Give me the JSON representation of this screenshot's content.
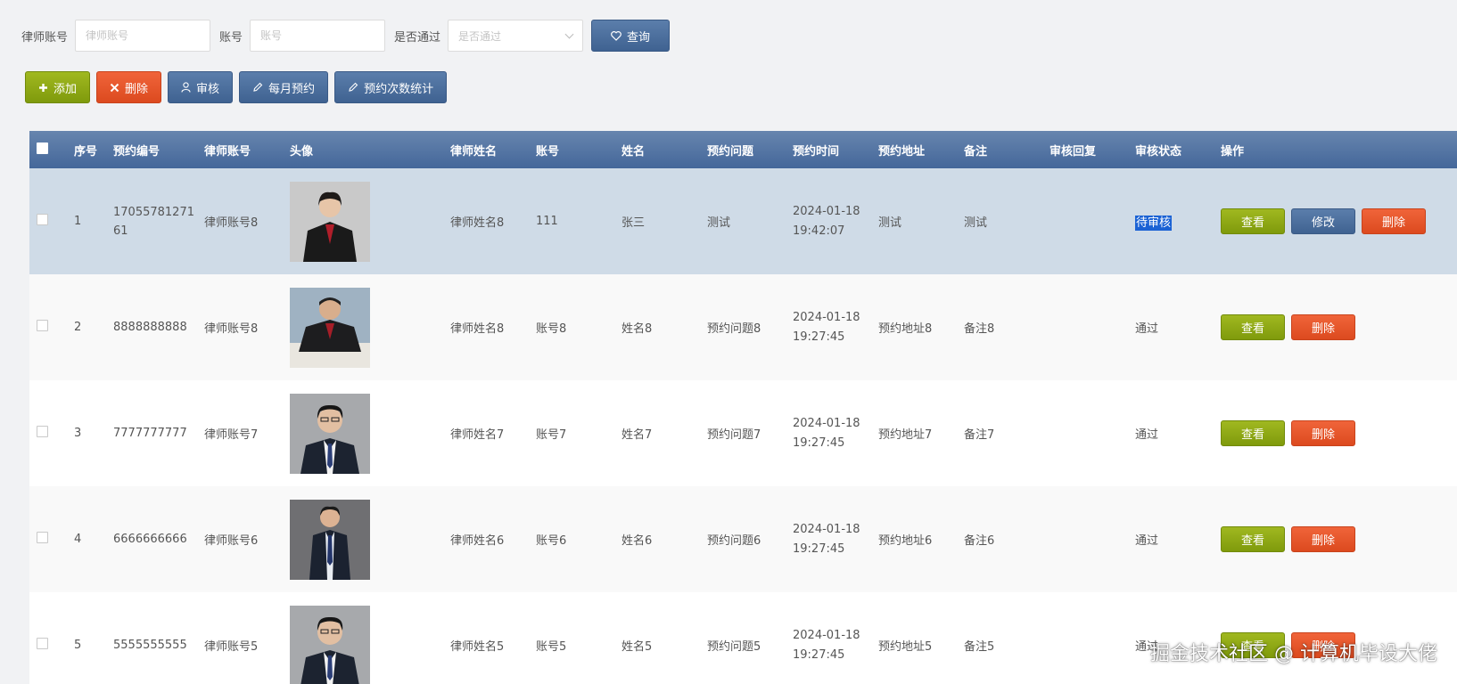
{
  "search": {
    "lawyer_account_label": "律师账号",
    "lawyer_account_placeholder": "律师账号",
    "account_label": "账号",
    "account_placeholder": "账号",
    "passed_label": "是否通过",
    "passed_placeholder": "是否通过",
    "query_label": "查询"
  },
  "toolbar": {
    "add_label": "添加",
    "delete_label": "删除",
    "review_label": "审核",
    "monthly_label": "每月预约",
    "stats_label": "预约次数统计"
  },
  "table": {
    "headers": [
      "序号",
      "预约编号",
      "律师账号",
      "头像",
      "律师姓名",
      "账号",
      "姓名",
      "预约问题",
      "预约时间",
      "预约地址",
      "备注",
      "审核回复",
      "审核状态",
      "操作"
    ],
    "rows": [
      {
        "seq": "1",
        "code": "17055781271 61",
        "lawyer_account": "律师账号8",
        "lawyer_name": "律师姓名8",
        "account": "111",
        "name": "张三",
        "question": "测试",
        "date": "2024-01-18",
        "time": "19:42:07",
        "address": "测试",
        "remark": "测试",
        "reply": "",
        "status": "待审核"
      },
      {
        "seq": "2",
        "code": "8888888888",
        "lawyer_account": "律师账号8",
        "lawyer_name": "律师姓名8",
        "account": "账号8",
        "name": "姓名8",
        "question": "预约问题8",
        "date": "2024-01-18",
        "time": "19:27:45",
        "address": "预约地址8",
        "remark": "备注8",
        "reply": "",
        "status": "通过"
      },
      {
        "seq": "3",
        "code": "7777777777",
        "lawyer_account": "律师账号7",
        "lawyer_name": "律师姓名7",
        "account": "账号7",
        "name": "姓名7",
        "question": "预约问题7",
        "date": "2024-01-18",
        "time": "19:27:45",
        "address": "预约地址7",
        "remark": "备注7",
        "reply": "",
        "status": "通过"
      },
      {
        "seq": "4",
        "code": "6666666666",
        "lawyer_account": "律师账号6",
        "lawyer_name": "律师姓名6",
        "account": "账号6",
        "name": "姓名6",
        "question": "预约问题6",
        "date": "2024-01-18",
        "time": "19:27:45",
        "address": "预约地址6",
        "remark": "备注6",
        "reply": "",
        "status": "通过"
      },
      {
        "seq": "5",
        "code": "5555555555",
        "lawyer_account": "律师账号5",
        "lawyer_name": "律师姓名5",
        "account": "账号5",
        "name": "姓名5",
        "question": "预约问题5",
        "date": "2024-01-18",
        "time": "19:27:45",
        "address": "预约地址5",
        "remark": "备注5",
        "reply": "",
        "status": "通过"
      }
    ],
    "view_label": "查看",
    "edit_label": "修改",
    "delete_label": "删除"
  },
  "watermark": "掘金技术社区 @ 计算机毕设大佬",
  "colors": {
    "header_blue": "#4a6d9e",
    "btn_green": "#8ca516",
    "btn_red": "#e4542a",
    "btn_blue": "#4f72a1",
    "selected_row": "#cfdbe7"
  }
}
